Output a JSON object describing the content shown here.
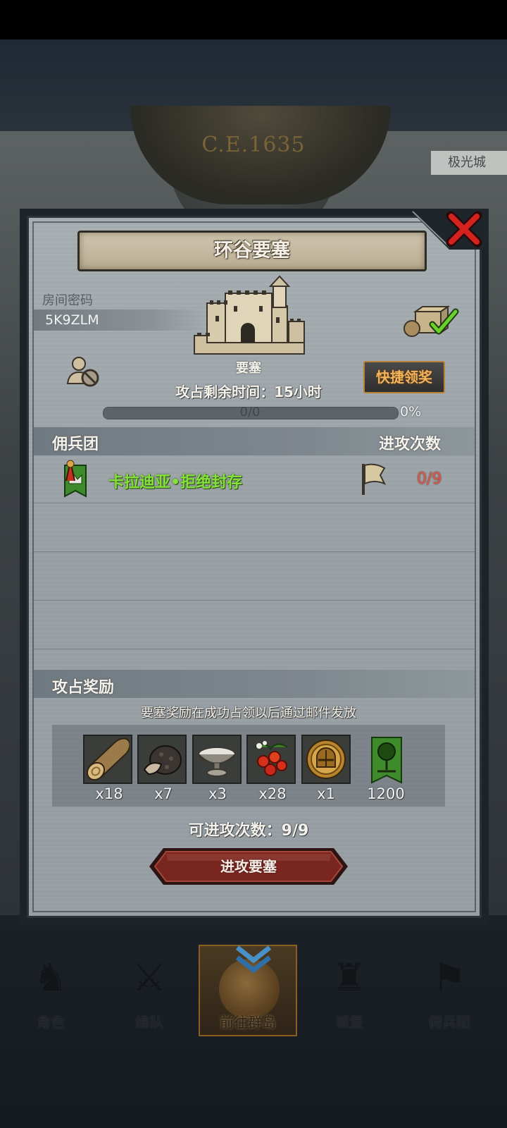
{
  "background": {
    "era": "C.E.1635",
    "place_tag": "极光城"
  },
  "dialog": {
    "title": "环谷要塞",
    "room": {
      "label": "房间密码",
      "code": "5K9ZLM"
    },
    "building_label": "要塞",
    "time_remaining": "攻占剩余时间：15小时",
    "progress": {
      "text": "0/0",
      "percent_text": "0%",
      "fraction": 0
    },
    "quick_claim_label": "快捷领奖",
    "mercenary_section": {
      "title": "佣兵团",
      "attacks_header": "进攻次数"
    },
    "mercenaries": [
      {
        "name": "卡拉迪亚•拒绝封存",
        "attacks": "0/9",
        "name_color": "#84e03c",
        "attacks_color": "#d8584c"
      }
    ],
    "rewards_section": {
      "title": "攻占奖励",
      "note": "要塞奖励在成功占领以后通过邮件发放"
    },
    "rewards": [
      {
        "icon": "wood-log-icon",
        "qty": "x18"
      },
      {
        "icon": "truffle-icon",
        "qty": "x7"
      },
      {
        "icon": "silver-bowl-icon",
        "qty": "x3"
      },
      {
        "icon": "berries-icon",
        "qty": "x28"
      },
      {
        "icon": "knight-helmet-coin-icon",
        "qty": "x1"
      },
      {
        "icon": "tree-banner-icon",
        "qty": "1200"
      }
    ],
    "attack_count": "可进攻次数：9/9",
    "attack_button_label": "进攻要塞"
  },
  "nav": [
    {
      "label": "角色",
      "icon": "knight-icon"
    },
    {
      "label": "编队",
      "icon": "formation-icon"
    },
    {
      "label": "前往群岛",
      "icon": "globe-icon",
      "active": true
    },
    {
      "label": "城堡",
      "icon": "castle-icon"
    },
    {
      "label": "佣兵团",
      "icon": "mercenary-icon"
    }
  ],
  "colors": {
    "accent_gold": "#f2b45a",
    "danger": "#d8584c",
    "success_green": "#84e03c",
    "attack_button": "#7a2620"
  }
}
